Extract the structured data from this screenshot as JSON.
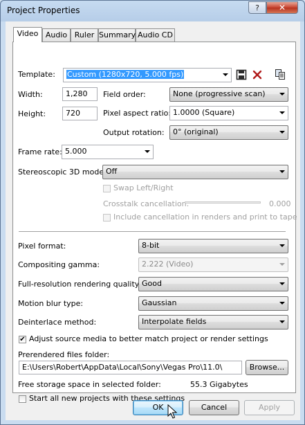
{
  "window": {
    "title": "Project Properties",
    "help_label": "?",
    "close_label": "✕"
  },
  "tabs": [
    "Video",
    "Audio",
    "Ruler",
    "Summary",
    "Audio CD"
  ],
  "video": {
    "template_label": "Template:",
    "template_value": "Custom (1280x720, 5.000 fps)",
    "width_label": "Width:",
    "width_value": "1,280",
    "height_label": "Height:",
    "height_value": "720",
    "field_order_label": "Field order:",
    "field_order_value": "None (progressive scan)",
    "pixel_aspect_label": "Pixel aspect ratio:",
    "pixel_aspect_value": "1.0000 (Square)",
    "output_rotation_label": "Output rotation:",
    "output_rotation_value": "0° (original)",
    "frame_rate_label": "Frame rate:",
    "frame_rate_value": "5.000",
    "stereo_label": "Stereoscopic 3D mode:",
    "stereo_value": "Off",
    "swap_label": "Swap Left/Right",
    "crosstalk_label": "Crosstalk cancellation:",
    "crosstalk_value": "0.000",
    "include_cancel_label": "Include cancellation in renders and print to tape",
    "pixel_format_label": "Pixel format:",
    "pixel_format_value": "8-bit",
    "gamma_label": "Compositing gamma:",
    "gamma_value": "2.222 (Video)",
    "quality_label": "Full-resolution rendering quality:",
    "quality_value": "Good",
    "motion_blur_label": "Motion blur type:",
    "motion_blur_value": "Gaussian",
    "deinterlace_label": "Deinterlace method:",
    "deinterlace_value": "Interpolate fields",
    "adjust_label": "Adjust source media to better match project or render settings",
    "adjust_checked": "✔",
    "prerendered_label": "Prerendered files folder:",
    "prerendered_value": "E:\\Users\\Robert\\AppData\\Local\\Sony\\Vegas Pro\\11.0\\",
    "browse_label": "Browse...",
    "free_space_label": "Free storage space in selected folder:",
    "free_space_value": "55.3 Gigabytes",
    "start_all_label": "Start all new projects with these settings"
  },
  "buttons": {
    "ok": "OK",
    "cancel": "Cancel",
    "apply": "Apply"
  },
  "colors": {
    "selection": "#3399ff",
    "title_bar": "#b9d1ea",
    "close_red": "#c7432f"
  },
  "icons": [
    "save-icon",
    "delete-icon",
    "copy-icon"
  ]
}
